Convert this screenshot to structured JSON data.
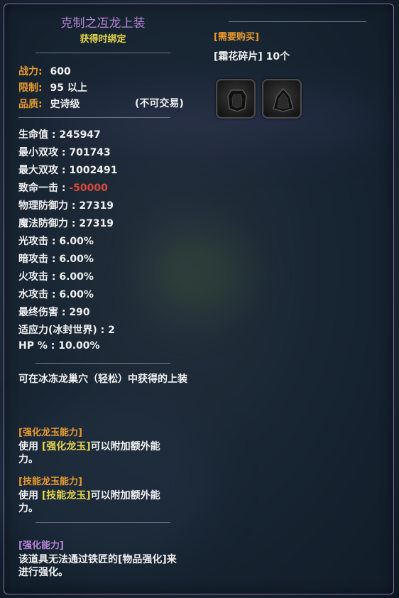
{
  "item": {
    "name": "克制之冱龙上装",
    "binding": "获得时绑定",
    "combat_power_label": "战力:",
    "combat_power_value": "600",
    "level_label": "限制:",
    "level_value": "95 以上",
    "quality_label": "品质:",
    "quality_value": "史诗级",
    "tradable": "(不可交易)",
    "stats": [
      "生命值 : 245947",
      "最小双攻 : 701743",
      "最大双攻 : 1002491",
      "物理防御力 : 27319",
      "魔法防御力 : 27319",
      "光攻击 : 6.00%",
      "暗攻击 : 6.00%",
      "火攻击 : 6.00%",
      "水攻击 : 6.00%",
      "最终伤害 : 290",
      "适应力(冰封世界) : 2",
      "HP % : 10.00%"
    ],
    "crit_label": "致命一击 : ",
    "crit_value": "-50000",
    "description": "可在冰冻龙巢穴（轻松）中获得的上装",
    "sections": {
      "dragon_jade_title": "[强化龙玉能力]",
      "dragon_jade_pre": "使用 ",
      "dragon_jade_link": "[强化龙玉]",
      "dragon_jade_post": "可以附加额外能力。",
      "skill_jade_title": "[技能龙玉能力]",
      "skill_jade_pre": "使用 ",
      "skill_jade_link": "[技能龙玉]",
      "skill_jade_post": "可以附加额外能力。",
      "enhance_title": "[强化能力]",
      "enhance_text": "该道具无法通过铁匠的[物品强化]来进行强化。"
    }
  },
  "purchase": {
    "title": "[需要购买]",
    "item": "[霜花碎片] 10个",
    "slots": [
      {
        "icon": "armor-chest-icon"
      },
      {
        "icon": "armor-cloak-icon"
      }
    ]
  },
  "colors": {
    "title_purple": "#b784d6",
    "label_orange": "#e89a2e",
    "bind_yellow": "#e6d54a",
    "negative_red": "#d94a3a"
  }
}
